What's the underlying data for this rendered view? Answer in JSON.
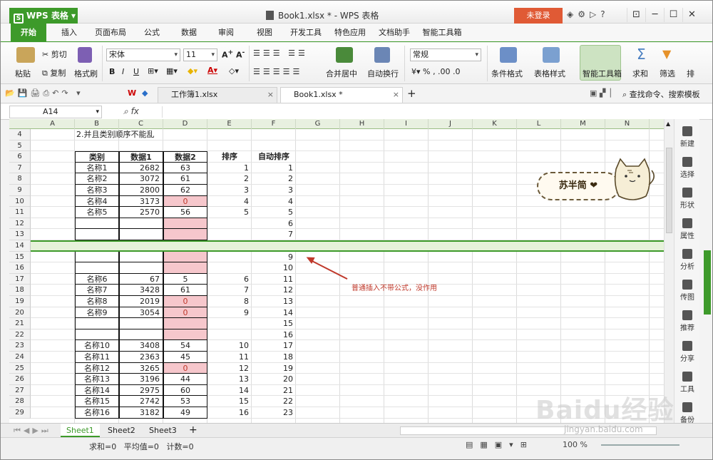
{
  "app": {
    "name": "WPS 表格",
    "window_title": "Book1.xlsx * - WPS 表格",
    "login": "未登录",
    "accent": "#3d9a2a"
  },
  "tabs": [
    "开始",
    "插入",
    "页面布局",
    "公式",
    "数据",
    "审阅",
    "视图",
    "开发工具",
    "特色应用",
    "文档助手",
    "智能工具箱"
  ],
  "ribbon": {
    "paste": "粘贴",
    "cut": "剪切",
    "copy": "复制",
    "format_painter": "格式刷",
    "font_name": "宋体",
    "font_size": "11",
    "merge_center": "合并居中",
    "wrap_text": "自动换行",
    "number_format": "常规",
    "cond_format": "条件格式",
    "table_style": "表格样式",
    "smart_toolbox": "智能工具箱",
    "sum": "求和",
    "filter": "筛选",
    "sort": "排"
  },
  "doctabs": [
    {
      "label": "工作簿1.xlsx"
    },
    {
      "label": "Book1.xlsx *"
    }
  ],
  "search_placeholder": "查找命令、搜索模板",
  "formula_bar": {
    "name_box": "A14",
    "fx": "fx"
  },
  "columns": [
    "A",
    "B",
    "C",
    "D",
    "E",
    "F",
    "G",
    "H",
    "I",
    "J",
    "K",
    "L",
    "M",
    "N"
  ],
  "rows": [
    "4",
    "5",
    "6",
    "7",
    "8",
    "9",
    "10",
    "11",
    "12",
    "13",
    "14",
    "15",
    "16",
    "17",
    "18",
    "19",
    "20",
    "21",
    "22",
    "23",
    "24",
    "25",
    "26",
    "27",
    "28",
    "29"
  ],
  "row4_text": "2.并且类别顺序不能乱",
  "table_header": [
    "类别",
    "数据1",
    "数据2",
    "排序",
    "自动排序"
  ],
  "table_rows": [
    [
      "名称1",
      "2682",
      "63",
      "1",
      "1"
    ],
    [
      "名称2",
      "3072",
      "61",
      "2",
      "2"
    ],
    [
      "名称3",
      "2800",
      "62",
      "3",
      "3"
    ],
    [
      "名称4",
      "3173",
      "0",
      "4",
      "4"
    ],
    [
      "名称5",
      "2570",
      "56",
      "5",
      "5"
    ],
    [
      "",
      "",
      "",
      "",
      "6"
    ],
    [
      "",
      "",
      "",
      "",
      "7"
    ],
    [
      "",
      "",
      "",
      "",
      ""
    ],
    [
      "",
      "",
      "",
      "",
      "9"
    ],
    [
      "",
      "",
      "",
      "",
      "10"
    ],
    [
      "名称6",
      "67",
      "5",
      "6",
      "11"
    ],
    [
      "名称7",
      "3428",
      "61",
      "7",
      "12"
    ],
    [
      "名称8",
      "2019",
      "0",
      "8",
      "13"
    ],
    [
      "名称9",
      "3054",
      "0",
      "9",
      "14"
    ],
    [
      "",
      "",
      "",
      "",
      "15"
    ],
    [
      "",
      "",
      "",
      "",
      "16"
    ],
    [
      "名称10",
      "3408",
      "54",
      "10",
      "17"
    ],
    [
      "名称11",
      "2363",
      "45",
      "11",
      "18"
    ],
    [
      "名称12",
      "3265",
      "0",
      "12",
      "19"
    ],
    [
      "名称13",
      "3196",
      "44",
      "13",
      "20"
    ],
    [
      "名称14",
      "2975",
      "60",
      "14",
      "21"
    ],
    [
      "名称15",
      "2742",
      "53",
      "15",
      "22"
    ],
    [
      "名称16",
      "3182",
      "49",
      "16",
      "23"
    ]
  ],
  "annotation": "普通插入不带公式，没作用",
  "badge_text": "苏半简 ❤",
  "right_panel": [
    "新建",
    "选择",
    "形状",
    "属性",
    "分析",
    "传图",
    "推荐",
    "分享",
    "工具",
    "备份"
  ],
  "sheet_tabs": [
    "Sheet1",
    "Sheet2",
    "Sheet3"
  ],
  "status": {
    "sum": "求和=0",
    "avg": "平均值=0",
    "count": "计数=0",
    "zoom": "100 %"
  },
  "watermark": "Baidu经验",
  "watermark_url": "jingyan.baidu.com"
}
